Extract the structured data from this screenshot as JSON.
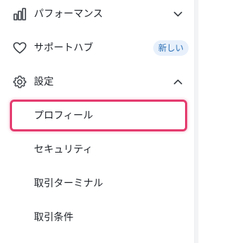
{
  "sidebar": {
    "items": [
      {
        "label": "パフォーマンス",
        "icon": "bar-chart-icon",
        "chevron": "down"
      },
      {
        "label": "サポートハブ",
        "icon": "heart-icon",
        "badge": "新しい"
      },
      {
        "label": "設定",
        "icon": "gear-icon",
        "chevron": "up"
      }
    ],
    "settings_subitems": [
      {
        "label": "プロフィール"
      },
      {
        "label": "セキュリティ"
      },
      {
        "label": "取引ターミナル"
      },
      {
        "label": "取引条件"
      }
    ]
  },
  "colors": {
    "highlight": "#e43b6e",
    "badge_bg": "#e7f0fb",
    "badge_text": "#2c6fb5",
    "text": "#1f2329",
    "icon": "#3a3f45"
  }
}
